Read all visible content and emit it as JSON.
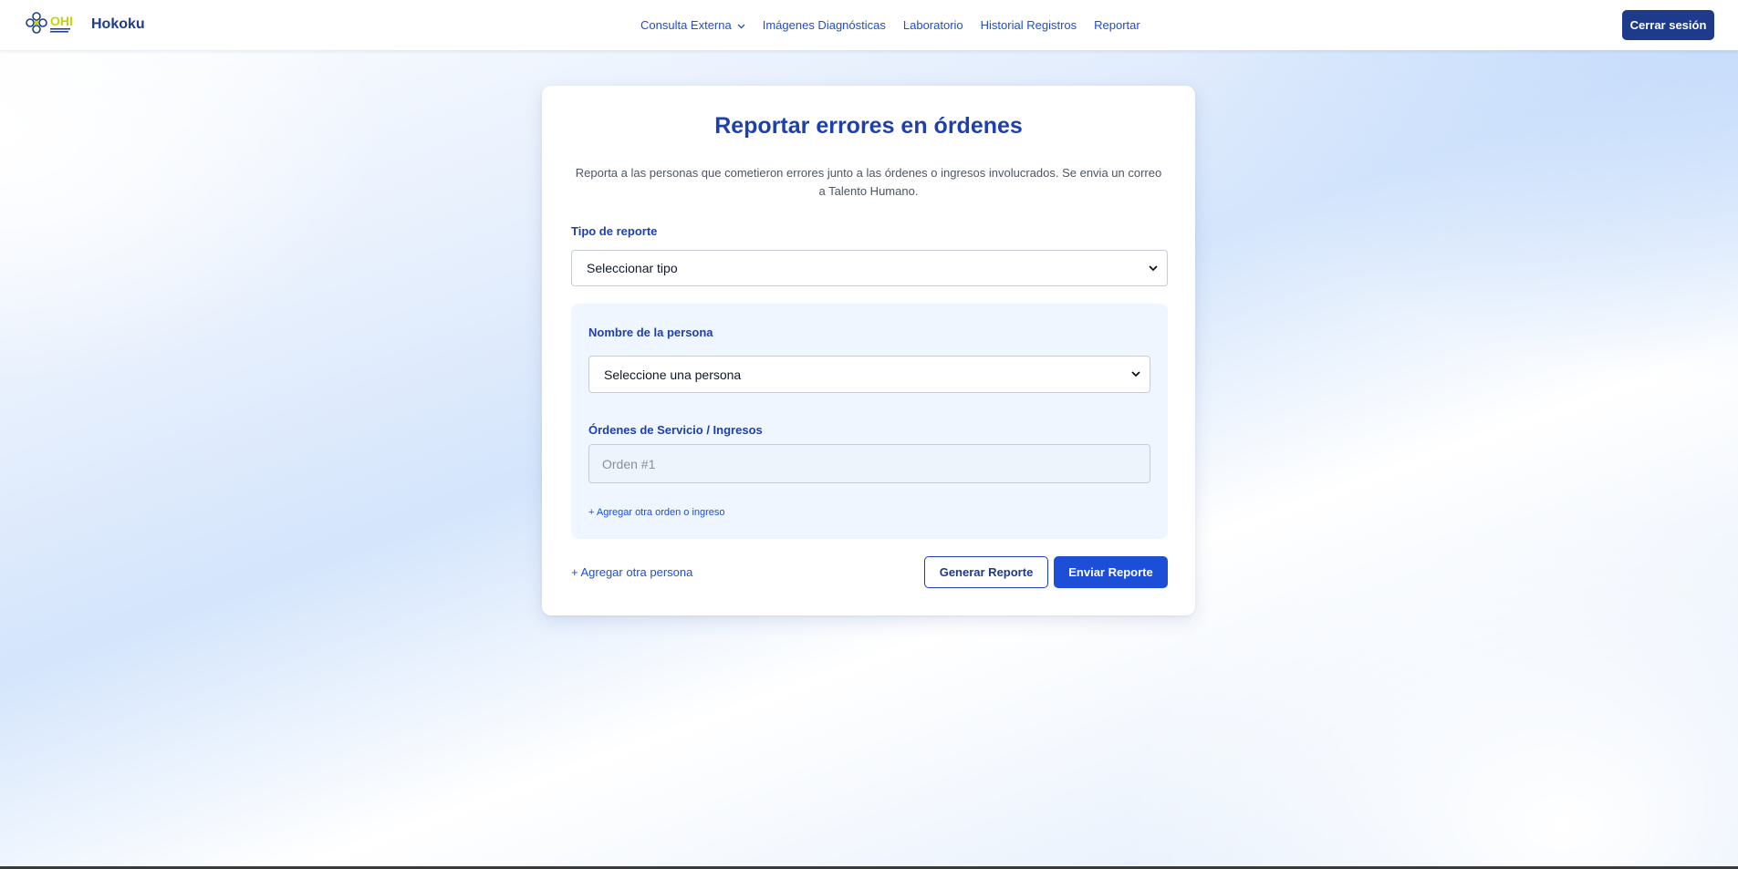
{
  "navbar": {
    "brand_name": "Hokoku",
    "logo_text": "OHI",
    "links": [
      {
        "label": "Consulta Externa",
        "has_dropdown": true
      },
      {
        "label": "Imágenes Diagnósticas"
      },
      {
        "label": "Laboratorio"
      },
      {
        "label": "Historial Registros"
      },
      {
        "label": "Reportar"
      }
    ],
    "logout_label": "Cerrar sesión"
  },
  "form": {
    "title": "Reportar errores en órdenes",
    "description": "Reporta a las personas que cometieron errores junto a las órdenes o ingresos involucrados. Se envia un correo a Talento Humano.",
    "tipo_label": "Tipo de reporte",
    "tipo_selected": "Seleccionar tipo",
    "persona": {
      "nombre_label": "Nombre de la persona",
      "persona_selected": "Seleccione una persona",
      "ordenes_label": "Órdenes de Servicio / Ingresos",
      "orden_placeholder": "Orden #1",
      "orden_value": "",
      "add_orden_label": "+ Agregar otra orden o ingreso"
    },
    "add_persona_label": "+ Agregar otra persona",
    "generar_label": "Generar Reporte",
    "enviar_label": "Enviar Reporte"
  },
  "colors": {
    "primary": "#1d4ed8",
    "primary_dark": "#1e3a8a",
    "panel_bg": "#eff6ff",
    "logo_yellow": "#c4d600"
  },
  "icons": [
    "logo-flower-icon",
    "chevron-down-icon"
  ]
}
